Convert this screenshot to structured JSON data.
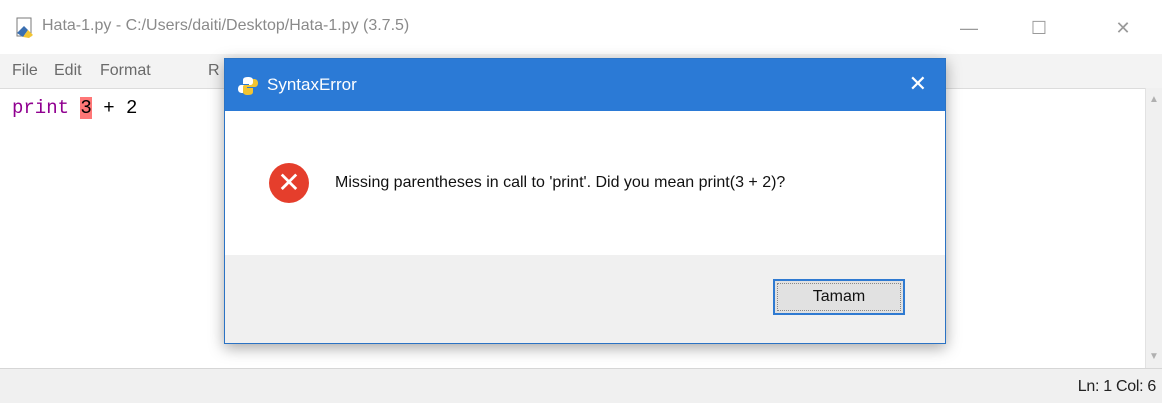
{
  "window": {
    "title": "Hata-1.py - C:/Users/daiti/Desktop/Hata-1.py (3.7.5)",
    "minimize_glyph": "—",
    "maximize_glyph": "☐",
    "close_glyph": "✕"
  },
  "menu": {
    "items": [
      "File",
      "Edit",
      "Format",
      "R"
    ]
  },
  "editor": {
    "keyword": "print",
    "error_token": "3",
    "rest": " + 2"
  },
  "status": {
    "position": "Ln: 1  Col: 6"
  },
  "dialog": {
    "title": "SyntaxError",
    "close_glyph": "✕",
    "message": "Missing parentheses in call to 'print'. Did you mean print(3 + 2)?",
    "ok_label": "Tamam",
    "error_icon_glyph": "✕"
  },
  "colors": {
    "dialog_titlebar": "#2b7ad6",
    "error_icon": "#e53e2c",
    "keyword": "#900090",
    "error_highlight": "#ff7777"
  }
}
